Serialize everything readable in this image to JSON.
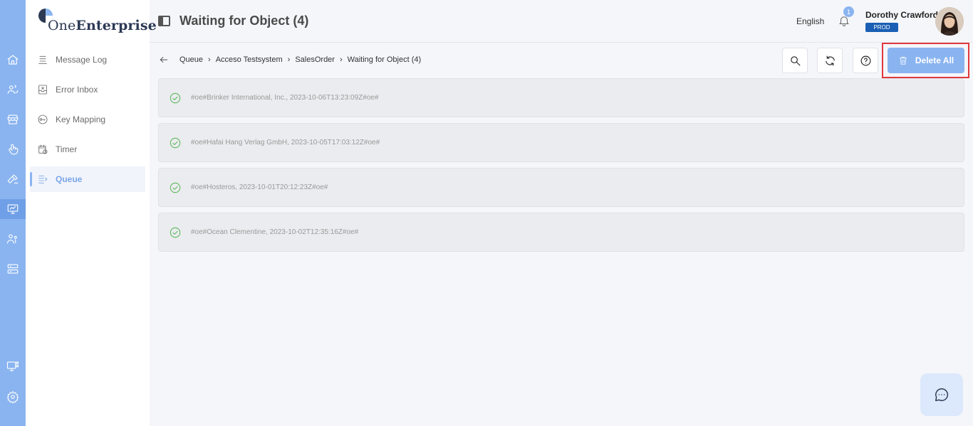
{
  "app": {
    "logo_text_light": "One",
    "logo_text_bold": "Enterprise",
    "brand_color": "#8ab4f0"
  },
  "rail": {
    "icons": [
      "home-icon",
      "users-sync-icon",
      "store-icon",
      "touch-icon",
      "hammer-icon",
      "monitor-chart-icon",
      "people-tie-icon",
      "server-icon",
      "monitor-grid-icon",
      "gear-icon"
    ],
    "active": "monitor-chart-icon"
  },
  "sidemenu": {
    "items": [
      {
        "label": "Message Log",
        "icon": "list-icon"
      },
      {
        "label": "Error Inbox",
        "icon": "inbox-error-icon"
      },
      {
        "label": "Key Mapping",
        "icon": "key-icon"
      },
      {
        "label": "Timer",
        "icon": "calendar-clock-icon"
      },
      {
        "label": "Queue",
        "icon": "queue-icon",
        "active": true
      }
    ]
  },
  "header": {
    "title": "Waiting for Object (4)",
    "language": "English",
    "notification_count": "1",
    "user_name": "Dorothy Crawford",
    "environment": "PROD"
  },
  "breadcrumb": [
    "Queue",
    "Acceso Testsystem",
    "SalesOrder",
    "Waiting for Object (4)"
  ],
  "toolbar": {
    "search_icon": "search-icon",
    "refresh_icon": "refresh-icon",
    "help_icon": "help-icon",
    "delete_all_label": "Delete All"
  },
  "queue": {
    "items": [
      {
        "text": "#oe#Brinker International, Inc., 2023-10-06T13:23:09Z#oe#",
        "status": "success"
      },
      {
        "text": "#oe#Hafai Hang Verlag GmbH, 2023-10-05T17:03:12Z#oe#",
        "status": "success"
      },
      {
        "text": "#oe#Hosteros, 2023-10-01T20:12:23Z#oe#",
        "status": "success"
      },
      {
        "text": "#oe#Ocean Clementine, 2023-10-02T12:35:16Z#oe#",
        "status": "success"
      }
    ],
    "success_color": "#5cb85c"
  },
  "chat": {
    "icon": "chat-icon"
  }
}
